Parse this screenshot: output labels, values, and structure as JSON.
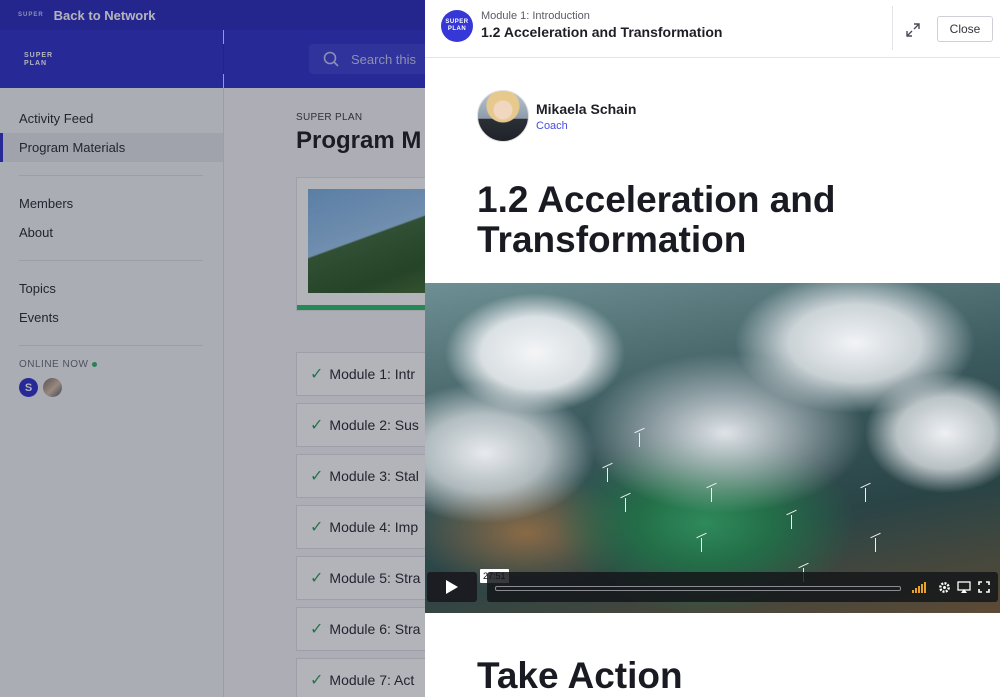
{
  "topbar": {
    "mini_logo": "SUPER",
    "back_label": "Back to Network"
  },
  "sidebar": {
    "logo_line1": "SUPER",
    "logo_line2": "PLAN",
    "items": [
      {
        "label": "Activity Feed"
      },
      {
        "label": "Program Materials"
      },
      {
        "label": "Members"
      },
      {
        "label": "About"
      },
      {
        "label": "Topics"
      },
      {
        "label": "Events"
      }
    ],
    "online_label": "ONLINE NOW",
    "online_user_initial": "S"
  },
  "search": {
    "placeholder": "Search this"
  },
  "content": {
    "eyebrow": "SUPER PLAN",
    "title": "Program M",
    "modules": [
      {
        "label": "Module 1: Intr"
      },
      {
        "label": "Module 2: Sus"
      },
      {
        "label": "Module 3: Stal"
      },
      {
        "label": "Module 4: Imp"
      },
      {
        "label": "Module 5: Stra"
      },
      {
        "label": "Module 6: Stra"
      },
      {
        "label": "Module 7: Act"
      }
    ]
  },
  "panel": {
    "badge_line1": "SUPER",
    "badge_line2": "PLAN",
    "subtitle": "Module 1: Introduction",
    "title": "1.2 Acceleration and Transformation",
    "close_label": "Close",
    "author": {
      "name": "Mikaela Schain",
      "role": "Coach"
    },
    "lesson_title": "1.2 Acceleration and Transformation",
    "video": {
      "timestamp": "27:51"
    },
    "next_heading": "Take Action"
  },
  "colors": {
    "brand": "#3133cc",
    "accent_green": "#2fc06a",
    "volume": "#e8a32a"
  }
}
